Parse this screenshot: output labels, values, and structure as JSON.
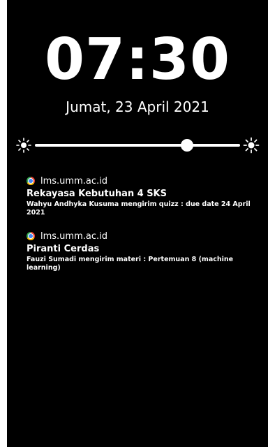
{
  "lockscreen": {
    "time": "07:30",
    "date": "Jumat, 23 April 2021"
  },
  "brightness": {
    "level": 0.74
  },
  "notifications": [
    {
      "source": "lms.umm.ac.id",
      "title": "Rekayasa Kebutuhan 4 SKS",
      "body": "Wahyu Andhyka Kusuma mengirim quizz : due date 24 April 2021",
      "icon": "chrome-icon"
    },
    {
      "source": "lms.umm.ac.id",
      "title": "Piranti Cerdas",
      "body": "Fauzi Sumadi mengirim materi : Pertemuan 8 (machine learning)",
      "icon": "chrome-icon"
    }
  ],
  "colors": {
    "background": "#000000",
    "foreground": "#ffffff"
  }
}
